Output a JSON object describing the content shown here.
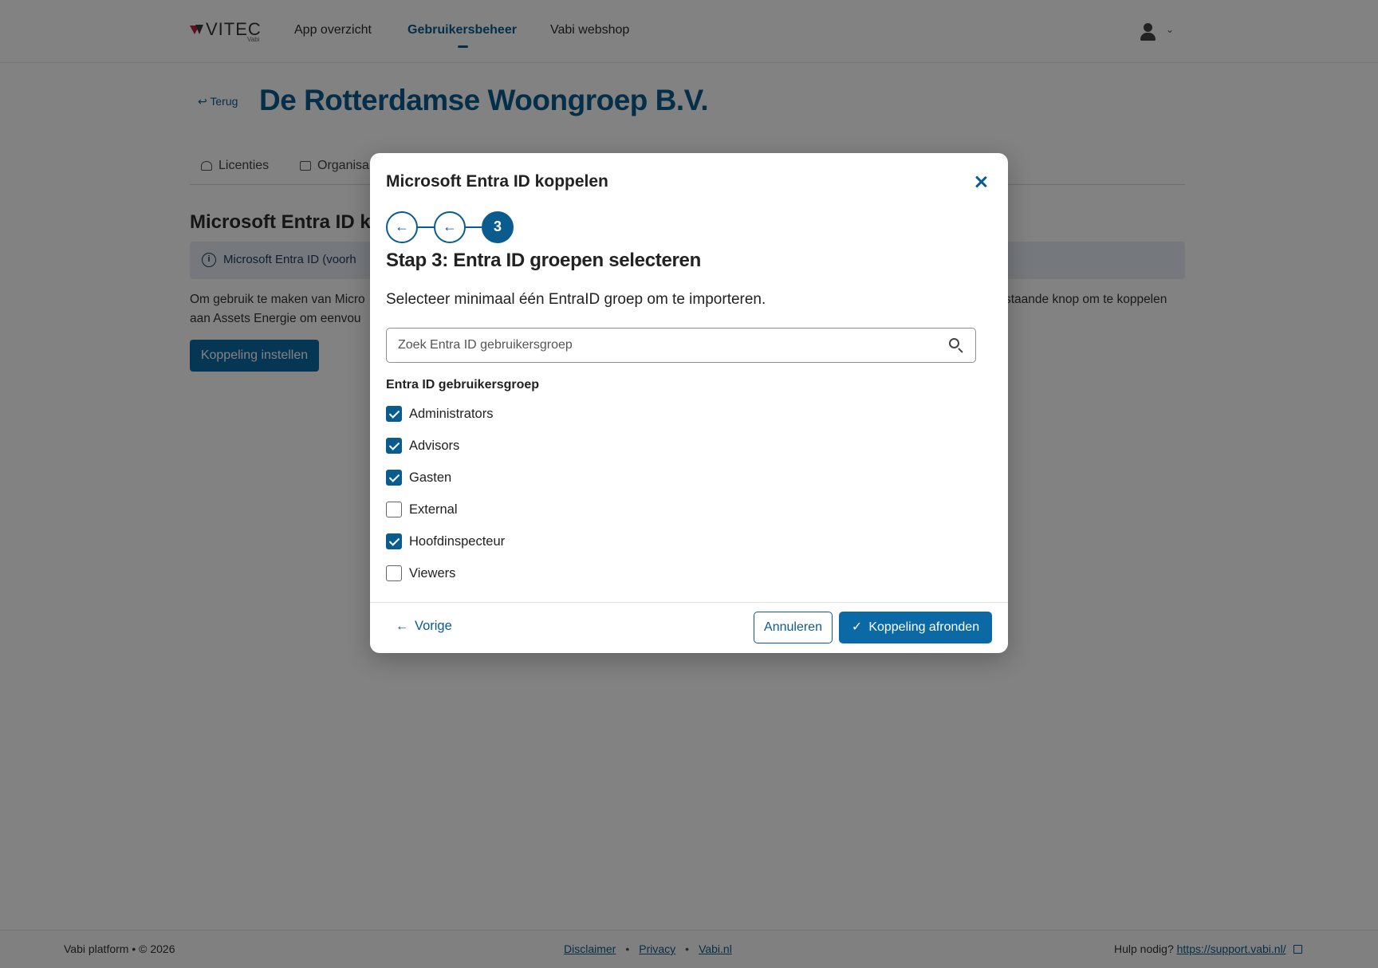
{
  "header": {
    "logo_text": "VITEC",
    "logo_sub": "Vabi",
    "nav": [
      {
        "label": "App overzicht"
      },
      {
        "label": "Gebruikersbeheer",
        "active": true
      },
      {
        "label": "Vabi webshop"
      }
    ],
    "user_icon": "person-icon",
    "chevron_icon": "chevron-down-icon"
  },
  "page": {
    "back_label": "Terug",
    "org_title": "De Rotterdamse Woongroep B.V.",
    "tabs": [
      {
        "label": "Licenties",
        "icon": "users-icon"
      },
      {
        "label": "Organisa",
        "icon": "briefcase-icon"
      }
    ],
    "heading": "Microsoft Entra ID ko",
    "info_text": "Microsoft Entra ID (voorh",
    "paragraph_line1_left": "Om gebruik te maken van Micro",
    "paragraph_line1_right": "staande knop om te koppelen",
    "paragraph_line2": "aan Assets Energie om eenvou",
    "setup_button": "Koppeling instellen"
  },
  "modal": {
    "title": "Microsoft Entra ID koppelen",
    "close_icon": "close-icon",
    "steps": [
      {
        "label": "←",
        "state": "done"
      },
      {
        "label": "←",
        "state": "done"
      },
      {
        "label": "3",
        "state": "active"
      }
    ],
    "step_title": "Stap 3: Entra ID groepen selecteren",
    "instruction": "Selecteer minimaal één EntraID groep om te importeren.",
    "search": {
      "placeholder": "Zoek Entra ID gebruikersgroep",
      "value": ""
    },
    "list_heading": "Entra ID gebruikersgroep",
    "groups": [
      {
        "label": "Administrators",
        "checked": true
      },
      {
        "label": "Advisors",
        "checked": true
      },
      {
        "label": "Gasten",
        "checked": true
      },
      {
        "label": "External",
        "checked": false
      },
      {
        "label": "Hoofdinspecteur",
        "checked": true
      },
      {
        "label": "Viewers",
        "checked": false
      }
    ],
    "footer": {
      "prev_label": "Vorige",
      "cancel_label": "Annuleren",
      "finish_label": "Koppeling afronden"
    }
  },
  "footer": {
    "copyright": "Vabi platform • © 2026",
    "links": [
      "Disclaimer",
      "Privacy",
      "Vabi.nl"
    ],
    "separator": "•",
    "help_label": "Hulp nodig?",
    "help_link": "https://support.vabi.nl/"
  },
  "colors": {
    "primary": "#0b5c8e",
    "button": "#0b6aa6",
    "overlay": "rgba(0,0,0,0.49)",
    "info_bg": "#e6eef6"
  }
}
